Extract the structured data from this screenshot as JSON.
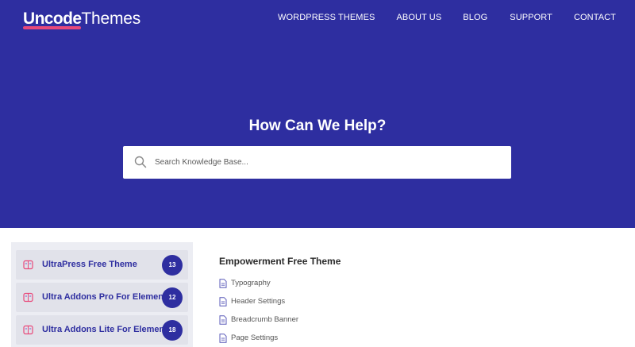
{
  "logo": {
    "bold": "Uncode",
    "light": "Themes"
  },
  "nav": {
    "items": [
      {
        "label": "WORDPRESS THEMES"
      },
      {
        "label": "ABOUT US"
      },
      {
        "label": "BLOG"
      },
      {
        "label": "SUPPORT"
      },
      {
        "label": "CONTACT"
      }
    ]
  },
  "hero": {
    "title": "How Can We Help?",
    "search_placeholder": "Search Knowledge Base..."
  },
  "sidebar": {
    "items": [
      {
        "label": "UltraPress Free Theme",
        "count": "13"
      },
      {
        "label": "Ultra Addons Pro For Elementor",
        "count": "12"
      },
      {
        "label": "Ultra Addons Lite For Elementor",
        "count": "18"
      }
    ]
  },
  "content": {
    "title": "Empowerment Free Theme",
    "docs": [
      {
        "label": "Typography"
      },
      {
        "label": "Header Settings"
      },
      {
        "label": "Breadcrumb Banner"
      },
      {
        "label": "Page Settings"
      }
    ]
  },
  "colors": {
    "hero_bg": "#2e2ea0",
    "accent_pink": "#e8497a",
    "badge_bg": "#2e2ea0",
    "sidebar_bg": "#ecedf3"
  },
  "icons": {
    "search": "search-icon",
    "sidebar_item": "book-icon",
    "doc": "document-icon"
  }
}
